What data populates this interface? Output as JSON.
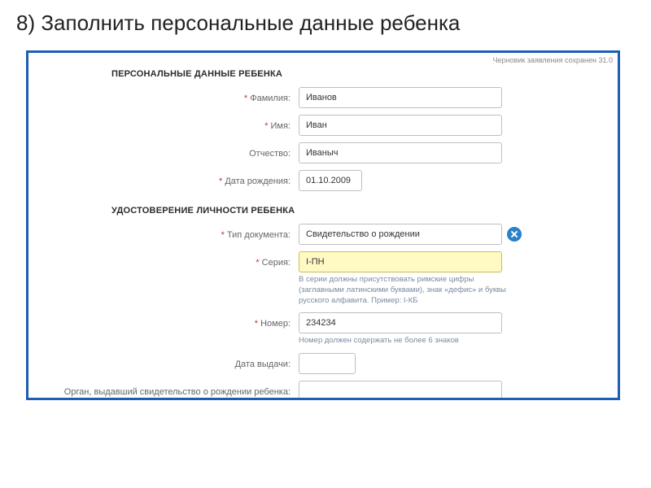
{
  "slide": {
    "title": "8) Заполнить персональные данные ребенка"
  },
  "panel": {
    "save_hint": "Черновик заявления сохранен 31.0"
  },
  "sections": {
    "child": "ПЕРСОНАЛЬНЫЕ ДАННЫЕ РЕБЕНКА",
    "identity": "УДОСТОВЕРЕНИЕ ЛИЧНОСТИ РЕБЕНКА"
  },
  "fields": {
    "lastname": {
      "label": "Фамилия:",
      "value": "Иванов"
    },
    "firstname": {
      "label": "Имя:",
      "value": "Иван"
    },
    "middlename": {
      "label": "Отчество:",
      "value": "Иваныч"
    },
    "birthdate": {
      "label": "Дата рождения:",
      "value": "01.10.2009"
    },
    "doctype": {
      "label": "Тип документа:",
      "value": "Свидетельство о рождении"
    },
    "series": {
      "label": "Серия:",
      "value": "I-ПН",
      "hint": "В серии должны присутствовать римские цифры (заглавными латинскими буквами), знак «дефис» и буквы русского алфавита. Пример: I-КБ"
    },
    "number": {
      "label": "Номер:",
      "value": "234234",
      "hint": "Номер должен содержать не более 6 знаков"
    },
    "issuedate": {
      "label": "Дата выдачи:",
      "value": ""
    },
    "issuer": {
      "label": "Орган, выдавший свидетельство о рождении ребенка:",
      "value": ""
    }
  }
}
